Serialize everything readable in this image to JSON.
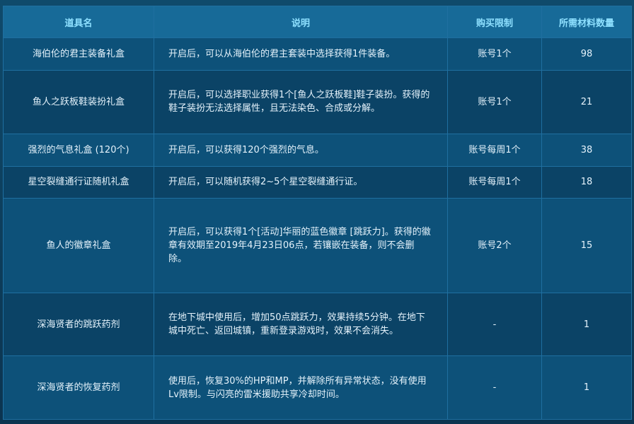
{
  "table": {
    "headers": [
      "道具名",
      "说明",
      "购买限制",
      "所需材料数量"
    ],
    "rows": [
      {
        "name": "海伯伦的君主装备礼盒",
        "desc": "开启后，可以从海伯伦的君主套装中选择获得1件装备。",
        "limit": "账号1个",
        "qty": "98"
      },
      {
        "name": "鱼人之跃板鞋装扮礼盒",
        "desc": "开启后，可以选择职业获得1个[鱼人之跃板鞋]鞋子装扮。获得的鞋子装扮无法选择属性，且无法染色、合成或分解。",
        "limit": "账号1个",
        "qty": "21"
      },
      {
        "name": "强烈的气息礼盒 (120个)",
        "desc": "开启后，可以获得120个强烈的气息。",
        "limit": "账号每周1个",
        "qty": "38"
      },
      {
        "name": "星空裂缝通行证随机礼盒",
        "desc": "开启后，可以随机获得2~5个星空裂缝通行证。",
        "limit": "账号每周1个",
        "qty": "18"
      },
      {
        "name": "鱼人的徽章礼盒",
        "desc": "开启后，可以获得1个[活动]华丽的蓝色徽章 [跳跃力]。获得的徽章有效期至2019年4月23日06点，若镶嵌在装备，则不会删除。",
        "limit": "账号2个",
        "qty": "15"
      },
      {
        "name": "深海贤者的跳跃药剂",
        "desc": "在地下城中使用后，增加50点跳跃力，效果持续5分钟。在地下城中死亡、返回城镇，重新登录游戏时，效果不会消失。",
        "limit": "-",
        "qty": "1"
      },
      {
        "name": "深海贤者的恢复药剂",
        "desc": "使用后，恢复30%的HP和MP，并解除所有异常状态，没有使用Lv限制。与闪亮的雷米援助共享冷却时间。",
        "limit": "-",
        "qty": "1"
      }
    ]
  }
}
